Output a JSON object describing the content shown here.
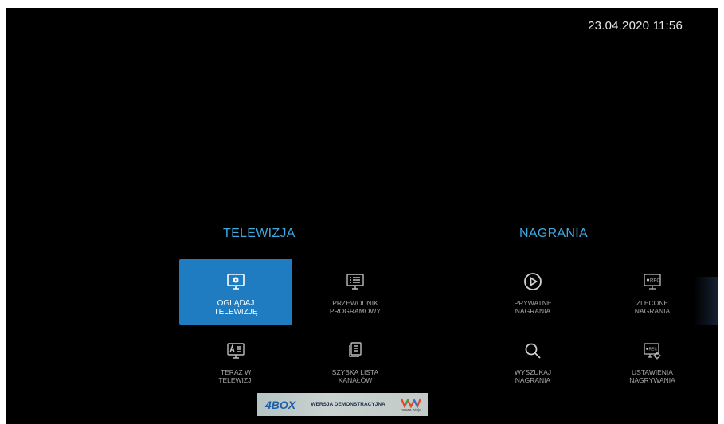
{
  "clock": "23.04.2020 11:56",
  "sections": {
    "tv_title": "TELEWIZJA",
    "rec_title": "NAGRANIA"
  },
  "tiles": {
    "watch_tv": {
      "label": "OGLĄDAJ\nTELEWIZJĘ",
      "icon": "tv-play-icon",
      "selected": true
    },
    "guide": {
      "label": "PRZEWODNIK\nPROGRAMOWY",
      "icon": "epg-list-icon"
    },
    "now_on_tv": {
      "label": "TERAZ W\nTELEWIZJI",
      "icon": "now-tv-icon"
    },
    "quick_list": {
      "label": "SZYBKA LISTA\nKANAŁÓW",
      "icon": "channel-list-icon"
    },
    "private_rec": {
      "label": "PRYWATNE\nNAGRANIA",
      "icon": "play-circle-icon"
    },
    "scheduled_rec": {
      "label": "ZLECONE\nNAGRANIA",
      "icon": "rec-tv-icon"
    },
    "search_rec": {
      "label": "WYSZUKAJ\nNAGRANIA",
      "icon": "search-icon"
    },
    "rec_settings": {
      "label": "USTAWIENIA\nNAGRYWANIA",
      "icon": "rec-settings-icon"
    }
  },
  "banner": {
    "logo": "4BOX",
    "demo": "WERSJA DEMONSTRACYJNA",
    "brand_caption": "nasza wizja"
  },
  "colors": {
    "accent": "#3fa9e0",
    "selected_tile": "#1f7cc0",
    "background": "#000000"
  }
}
